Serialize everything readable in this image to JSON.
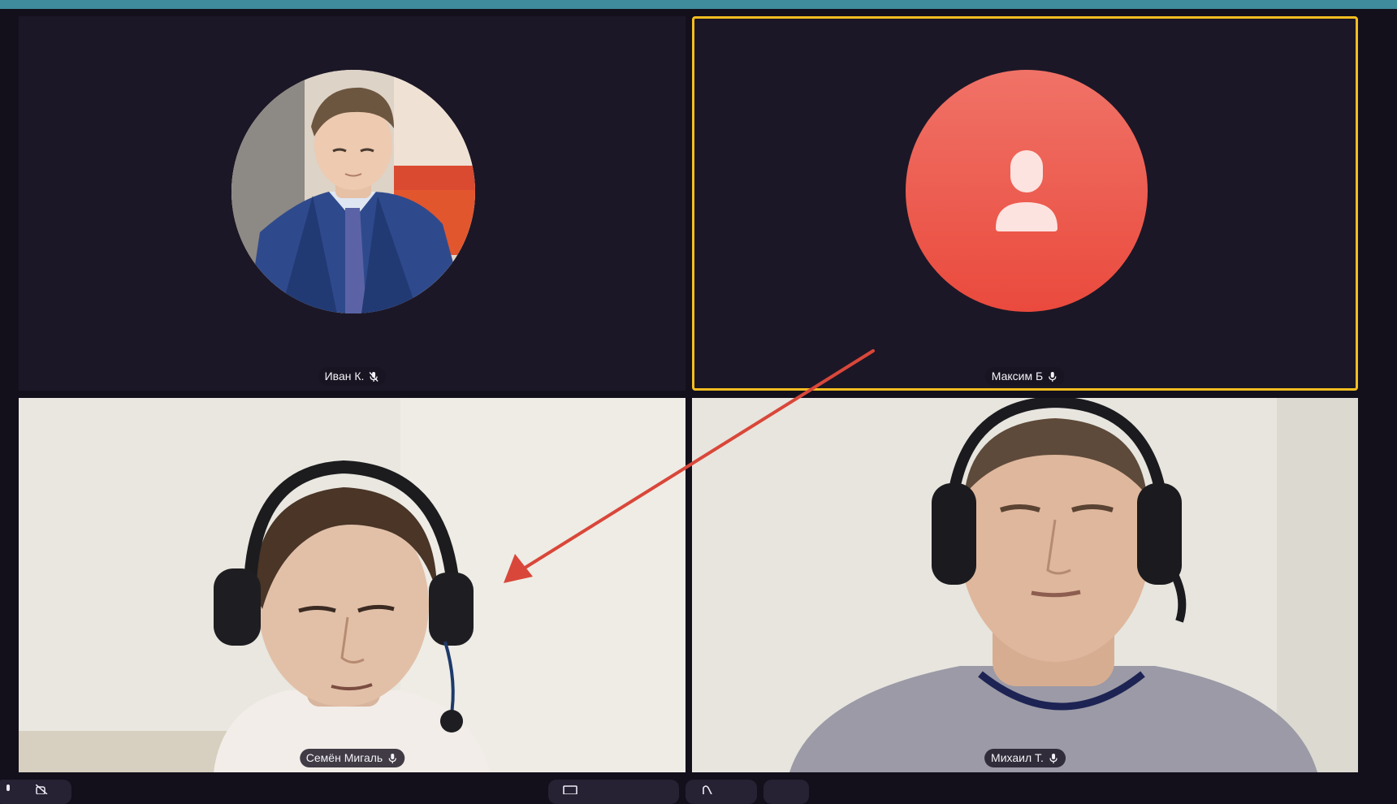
{
  "participants": [
    {
      "name": "Иван К.",
      "mic": "muted"
    },
    {
      "name": "Максим Б",
      "mic": "on",
      "speaking": true
    },
    {
      "name": "Семён Мигаль",
      "mic": "on"
    },
    {
      "name": "Михаил Т.",
      "mic": "on"
    }
  ],
  "icons": {
    "mic_on": "microphone-icon",
    "mic_off": "microphone-muted-icon",
    "placeholder": "user-silhouette-icon"
  },
  "colors": {
    "top_strip": "#3e8c9c",
    "page_background": "#13101c",
    "tile_background": "#1c1726",
    "active_speaker_border": "#f5bd1f",
    "placeholder_avatar": "#ea4a3d",
    "annotation_arrow": "#d9473a"
  }
}
